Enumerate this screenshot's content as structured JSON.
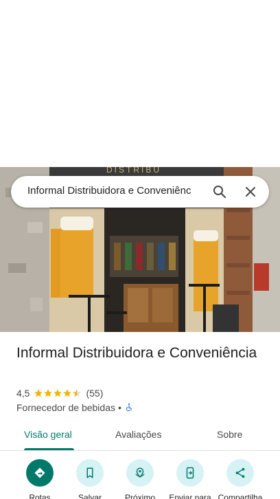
{
  "search": {
    "query": "Informal Distribuidora e Conveniênc"
  },
  "place": {
    "title": "Informal Distribuidora e Conveniência",
    "rating": "4,5",
    "review_count": "(55)",
    "stars_filled": 4.5,
    "category": "Fornecedor de bebidas",
    "separator": "•",
    "photo_sign_text": "DISTRIBU"
  },
  "tabs": [
    {
      "label": "Visão geral",
      "active": true
    },
    {
      "label": "Avaliações",
      "active": false
    },
    {
      "label": "Sobre",
      "active": false
    }
  ],
  "actions": [
    {
      "label": "Rotas",
      "icon": "directions-icon"
    },
    {
      "label": "Salvar",
      "icon": "bookmark-icon"
    },
    {
      "label": "Próximo",
      "icon": "nearby-icon"
    },
    {
      "label": "Enviar para",
      "icon": "send-to-phone-icon"
    },
    {
      "label": "Compartilha",
      "icon": "share-icon"
    }
  ],
  "colors": {
    "accent": "#00796b",
    "action_bg": "#d6f2f5",
    "star": "#f4b400",
    "wheelchair": "#1a73e8"
  }
}
